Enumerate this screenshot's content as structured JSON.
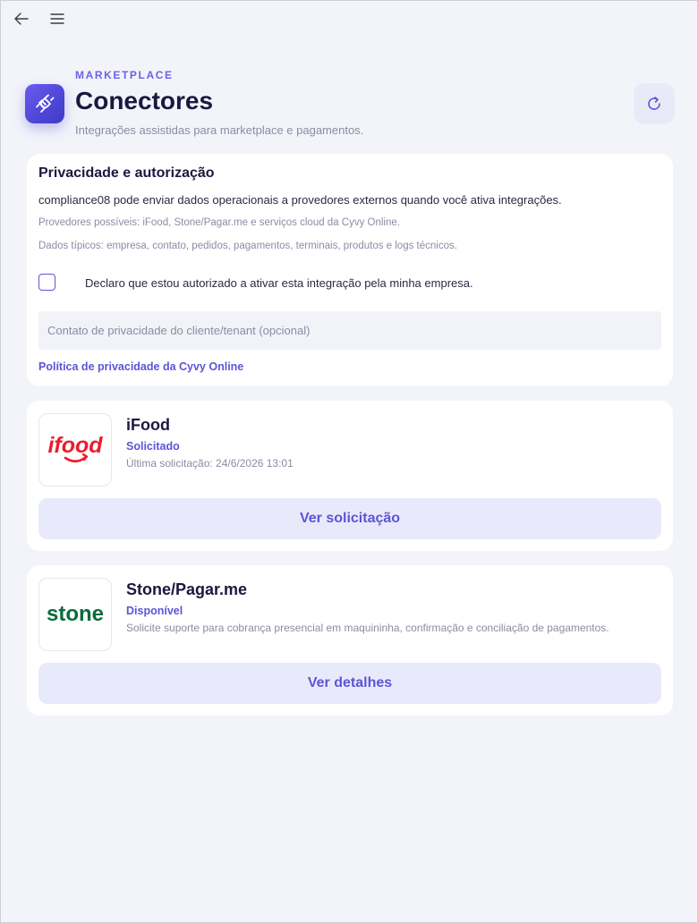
{
  "header": {
    "eyebrow": "MARKETPLACE",
    "title": "Conectores",
    "subtitle": "Integrações assistidas para marketplace e pagamentos."
  },
  "privacy": {
    "title": "Privacidade e autorização",
    "line1": "compliance08 pode enviar dados operacionais a provedores externos quando você ativa integrações.",
    "line2": "Provedores possíveis: iFood, Stone/Pagar.me e serviços cloud da Cyvy Online.",
    "line3": "Dados típicos: empresa, contato, pedidos, pagamentos, terminais, produtos e logs técnicos.",
    "checkbox_label": "Declaro que estou autorizado a ativar esta integração pela minha empresa.",
    "checkbox_checked": false,
    "contact_placeholder": "Contato de privacidade do cliente/tenant (opcional)",
    "contact_value": "",
    "policy_link": "Política de privacidade da Cyvy Online"
  },
  "connectors": [
    {
      "logo_text": "ifood",
      "name": "iFood",
      "status": "Solicitado",
      "detail": "Última solicitação: 24/6/2026 13:01",
      "action": "Ver solicitação"
    },
    {
      "logo_text": "stone",
      "name": "Stone/Pagar.me",
      "status": "Disponível",
      "detail": "Solicite suporte para cobrança presencial em maquininha, confirmação e conciliação de pagamentos.",
      "action": "Ver detalhes"
    }
  ],
  "icons": {
    "back": "arrow-left-icon",
    "menu": "hamburger-menu-icon",
    "app": "plug-link-icon",
    "refresh": "refresh-icon"
  },
  "colors": {
    "accent": "#5b55d8",
    "background": "#f3f4f9",
    "ifood_red": "#ea1d2c",
    "stone_green": "#0b6b3a"
  }
}
